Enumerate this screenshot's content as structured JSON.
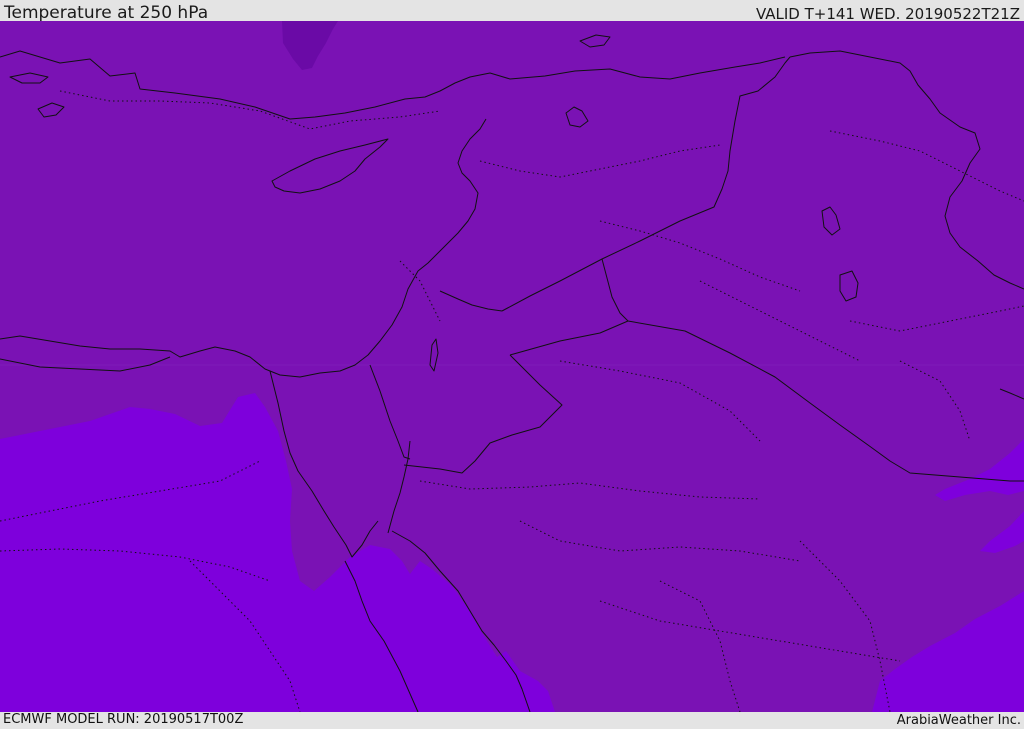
{
  "header": {
    "title": "Temperature at 250 hPa",
    "valid_time": "VALID T+141 WED. 20190522T21Z"
  },
  "footer": {
    "model_run": "ECMWF MODEL RUN: 20190517T00Z",
    "credit": "ArabiaWeather Inc."
  },
  "map": {
    "field": "Temperature at 250 hPa",
    "colors": {
      "main_fill": "#7a12b4",
      "warm_fill": "#7e00dc",
      "cold_fill": "#6a0aa6",
      "borders": "#111111"
    }
  }
}
